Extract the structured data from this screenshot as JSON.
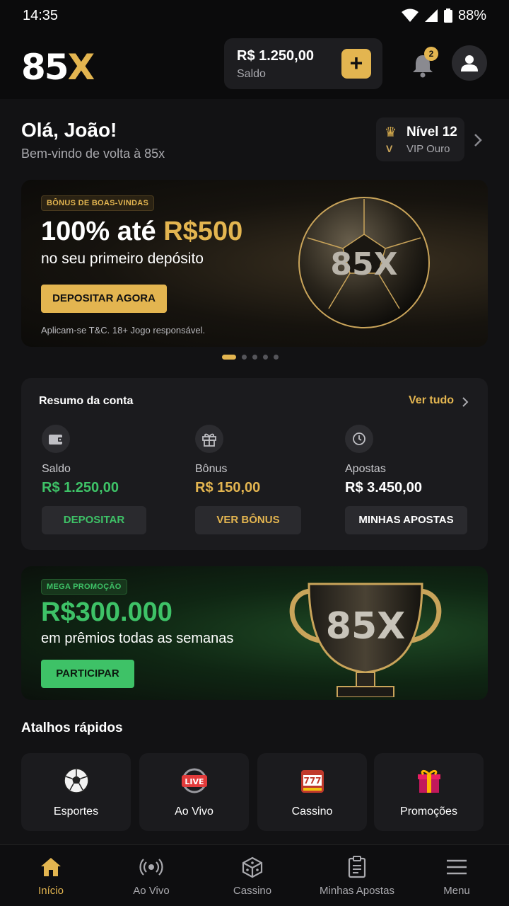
{
  "status_bar": {
    "time": "14:35",
    "battery": "88%"
  },
  "app_bar": {
    "logo_main": "85",
    "logo_accent": "X",
    "balance_amount": "R$ 1.250,00",
    "balance_label": "Saldo",
    "add_funds_icon": "plus-icon",
    "notifications_count": "2",
    "notification_icon": "bell-icon",
    "profile_icon": "user-icon"
  },
  "greeting": {
    "title": "Olá, João!",
    "subtitle": "Bem-vindo de volta à 85x",
    "level": "Nível 12",
    "vip_mark": "V",
    "vip_tier": "VIP Ouro"
  },
  "welcome_banner": {
    "tag": "BÔNUS DE BOAS-VINDAS",
    "headline_plain": "100% até ",
    "headline_gold": "R$500",
    "subtitle": "no seu primeiro depósito",
    "cta": "DEPOSITAR AGORA",
    "terms": "Aplicam-se T&C. 18+ Jogo responsável.",
    "ball_text": "85X"
  },
  "carousel": {
    "count": 5,
    "active_index": 0
  },
  "account_summary": {
    "title": "Resumo da conta",
    "see_all": "Ver tudo",
    "columns": [
      {
        "label": "Saldo",
        "value": "R$ 1.250,00",
        "color": "#3ec267",
        "icon": "wallet-icon",
        "button": "DEPOSITAR",
        "button_color": "#3ec267"
      },
      {
        "label": "Bônus",
        "value": "R$ 150,00",
        "color": "#e3b550",
        "icon": "gift-icon",
        "button": "VER BÔNUS",
        "button_color": "#e3b550"
      },
      {
        "label": "Apostas",
        "value": "R$ 3.450,00",
        "color": "#ffffff",
        "icon": "history-icon",
        "button": "MINHAS APOSTAS",
        "button_color": "#ffffff"
      }
    ]
  },
  "promo_banner": {
    "tag": "MEGA PROMOÇÃO",
    "amount": "R$300.000",
    "subtitle": "em prêmios todas as semanas",
    "cta": "PARTICIPAR",
    "trophy_text": "85X"
  },
  "quick_links": {
    "title": "Atalhos rápidos",
    "items": [
      {
        "label": "Esportes",
        "icon": "soccer-ball-icon"
      },
      {
        "label": "Ao Vivo",
        "icon": "live-icon",
        "badge": "LIVE"
      },
      {
        "label": "Cassino",
        "icon": "slot-machine-icon",
        "badge": "777"
      },
      {
        "label": "Promoções",
        "icon": "gift-icon"
      }
    ]
  },
  "bottom_nav": {
    "items": [
      {
        "label": "Início",
        "icon": "home-icon",
        "active": true
      },
      {
        "label": "Ao Vivo",
        "icon": "broadcast-icon",
        "active": false
      },
      {
        "label": "Cassino",
        "icon": "dice-icon",
        "active": false
      },
      {
        "label": "Minhas Apostas",
        "icon": "bet-slip-icon",
        "active": false
      },
      {
        "label": "Menu",
        "icon": "hamburger-menu-icon",
        "active": false
      }
    ]
  },
  "colors": {
    "gold": "#e3b550",
    "green": "#3ec267",
    "background": "#121214",
    "card": "#1b1b1e"
  }
}
